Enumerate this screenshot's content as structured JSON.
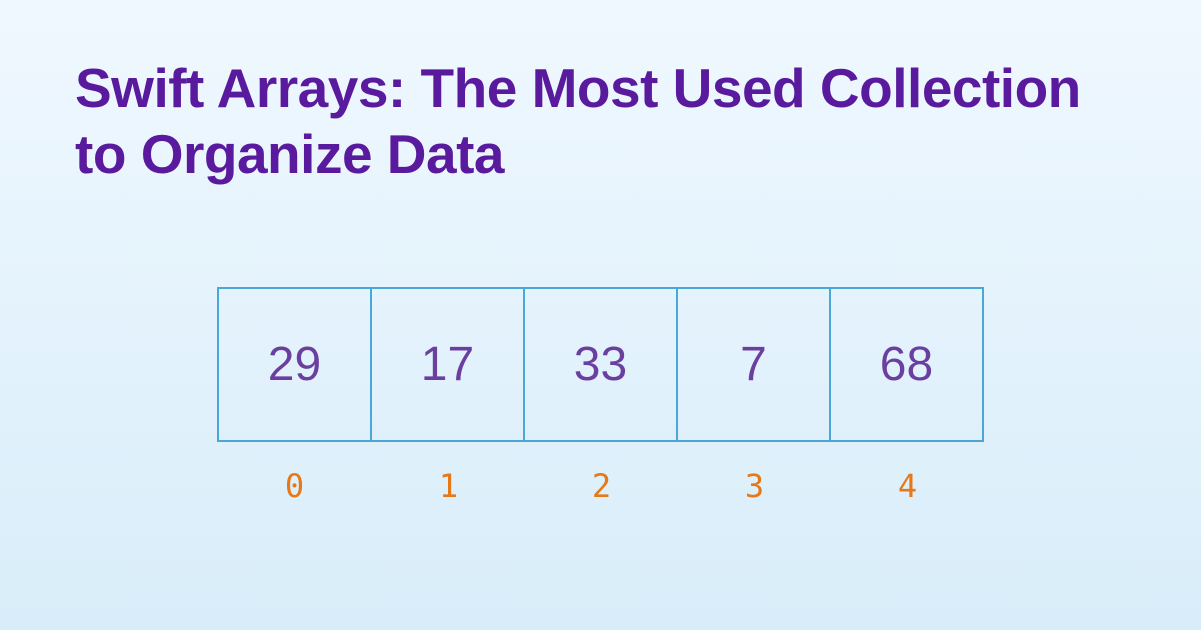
{
  "title": "Swift Arrays: The Most Used Collection to Organize Data",
  "array": {
    "values": [
      29,
      17,
      33,
      7,
      68
    ],
    "indices": [
      0,
      1,
      2,
      3,
      4
    ]
  }
}
